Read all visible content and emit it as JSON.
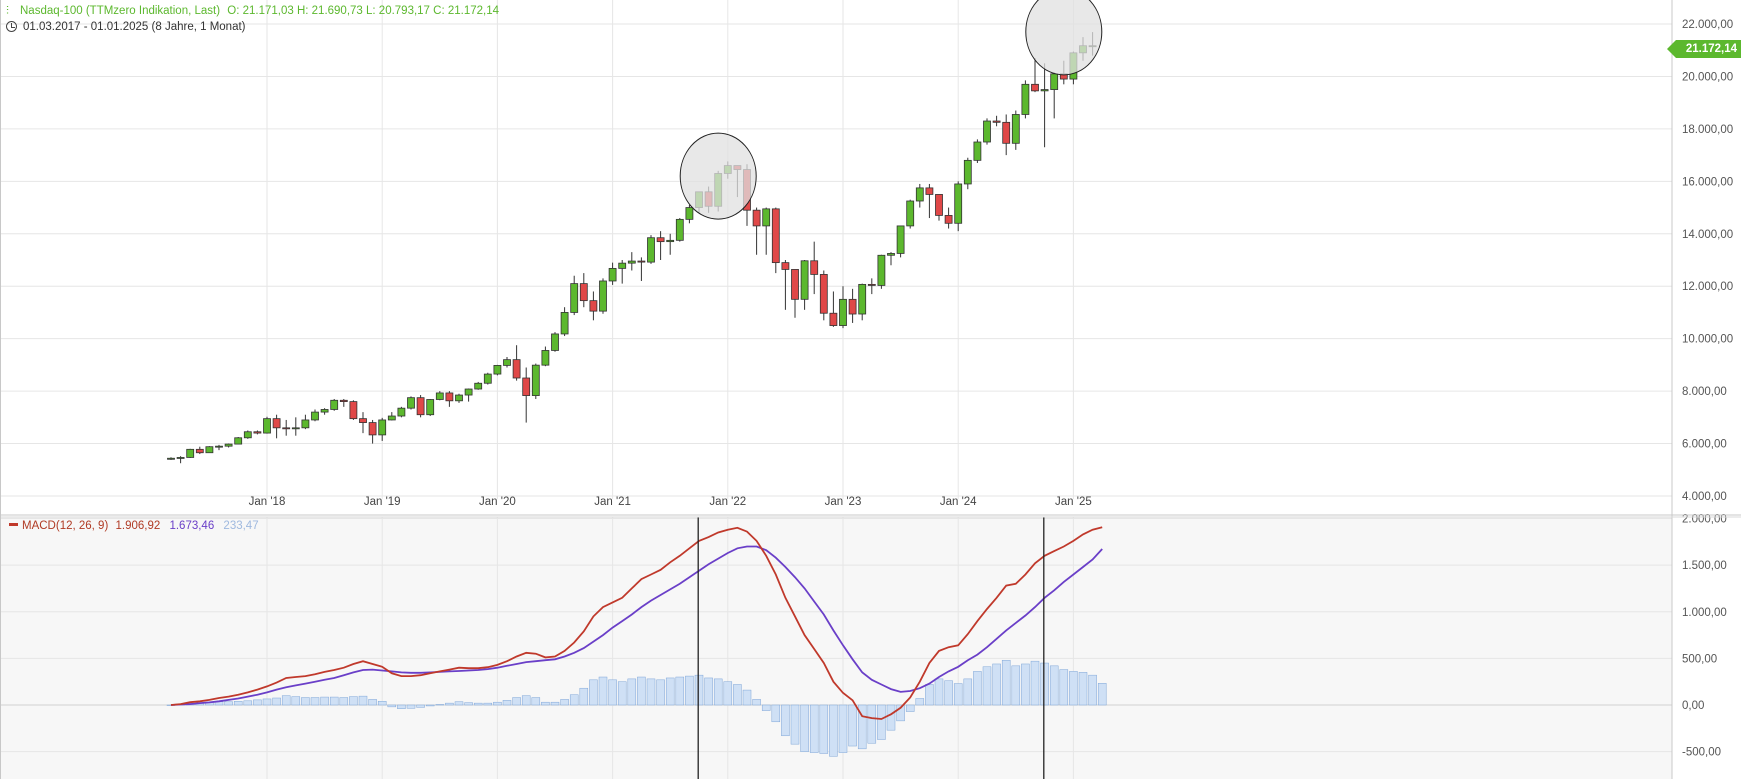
{
  "header": {
    "icon": "candlestick-icon",
    "instrument": "Nasdaq-100 (TTMzero Indikation, Last)",
    "ohlc": "O: 21.171,03   H: 21.690,73   L: 20.793,17   C: 21.172,14",
    "range_icon": "clock-icon",
    "range": "01.03.2017 - 01.01.2025   (8 Jahre, 1 Monat)"
  },
  "last_price_label": "21.172,14",
  "macd_legend": {
    "name": "MACD(12, 26, 9)",
    "macd_value": "1.906,92",
    "signal_value": "1.673,46",
    "hist_value": "233,47"
  },
  "colors": {
    "up": "#5cb82e",
    "down": "#e04848",
    "macd_line": "#c0392b",
    "signal_line": "#6a3fc8",
    "histogram": "#cfe0f5",
    "histogram_border": "#7fa6d8",
    "grid": "#e6e6e6",
    "highlight_circle": "#e0e0e0"
  },
  "chart_data": [
    {
      "type": "candlestick",
      "interval": "monthly",
      "start": "2017-03",
      "ylim": [
        4000,
        22000
      ],
      "y_ticks": [
        "4.000,00",
        "6.000,00",
        "8.000,00",
        "10.000,00",
        "12.000,00",
        "14.000,00",
        "16.000,00",
        "18.000,00",
        "20.000,00",
        "22.000,00"
      ],
      "x_ticks": [
        "Jan '18",
        "Jan '19",
        "Jan '20",
        "Jan '21",
        "Jan '22",
        "Jan '23",
        "Jan '24",
        "Jan '25"
      ],
      "ohlc": [
        [
          5400,
          5480,
          5380,
          5440
        ],
        [
          5440,
          5520,
          5250,
          5470
        ],
        [
          5470,
          5800,
          5450,
          5780
        ],
        [
          5780,
          5880,
          5600,
          5650
        ],
        [
          5650,
          5900,
          5640,
          5880
        ],
        [
          5880,
          5950,
          5750,
          5900
        ],
        [
          5900,
          6000,
          5850,
          5980
        ],
        [
          5980,
          6250,
          5970,
          6220
        ],
        [
          6220,
          6500,
          6180,
          6450
        ],
        [
          6450,
          6500,
          6350,
          6400
        ],
        [
          6400,
          7020,
          6380,
          6950
        ],
        [
          6950,
          7100,
          6200,
          6600
        ],
        [
          6600,
          6900,
          6300,
          6580
        ],
        [
          6580,
          7000,
          6300,
          6600
        ],
        [
          6600,
          7100,
          6550,
          6900
        ],
        [
          6900,
          7300,
          6850,
          7200
        ],
        [
          7200,
          7350,
          7100,
          7300
        ],
        [
          7300,
          7700,
          7250,
          7650
        ],
        [
          7650,
          7700,
          7400,
          7600
        ],
        [
          7600,
          7650,
          6900,
          6950
        ],
        [
          6950,
          7200,
          6400,
          6800
        ],
        [
          6800,
          6900,
          6000,
          6330
        ],
        [
          6330,
          6980,
          6100,
          6900
        ],
        [
          6900,
          7200,
          6880,
          7050
        ],
        [
          7050,
          7400,
          7000,
          7350
        ],
        [
          7350,
          7800,
          7300,
          7750
        ],
        [
          7750,
          7850,
          7000,
          7100
        ],
        [
          7100,
          7700,
          7050,
          7680
        ],
        [
          7680,
          8000,
          7650,
          7930
        ],
        [
          7930,
          8000,
          7400,
          7630
        ],
        [
          7630,
          7900,
          7550,
          7850
        ],
        [
          7850,
          8100,
          7600,
          8080
        ],
        [
          8080,
          8350,
          8050,
          8300
        ],
        [
          8300,
          8700,
          8250,
          8650
        ],
        [
          8650,
          9000,
          8600,
          8980
        ],
        [
          8980,
          9300,
          8900,
          9200
        ],
        [
          9200,
          9750,
          8400,
          8500
        ],
        [
          8500,
          8900,
          6800,
          7830
        ],
        [
          7830,
          9050,
          7700,
          8990
        ],
        [
          8990,
          9700,
          8950,
          9550
        ],
        [
          9550,
          10250,
          9500,
          10180
        ],
        [
          10180,
          11200,
          10100,
          11000
        ],
        [
          11000,
          12400,
          10900,
          12100
        ],
        [
          12100,
          12500,
          11200,
          11450
        ],
        [
          11450,
          11800,
          10700,
          11050
        ],
        [
          11050,
          12300,
          10950,
          12200
        ],
        [
          12200,
          12900,
          12050,
          12680
        ],
        [
          12680,
          13000,
          12100,
          12880
        ],
        [
          12880,
          13300,
          12600,
          12960
        ],
        [
          12960,
          13100,
          12200,
          12920
        ],
        [
          12920,
          13950,
          12850,
          13850
        ],
        [
          13850,
          14100,
          13000,
          13700
        ],
        [
          13700,
          14000,
          13200,
          13750
        ],
        [
          13750,
          14600,
          13700,
          14550
        ],
        [
          14550,
          15100,
          14400,
          15000
        ],
        [
          15000,
          15600,
          14800,
          15600
        ],
        [
          15600,
          15800,
          14800,
          15050
        ],
        [
          15050,
          16400,
          14850,
          16300
        ],
        [
          16300,
          16760,
          16100,
          16600
        ],
        [
          16600,
          16600,
          15400,
          16450
        ],
        [
          16450,
          16650,
          14300,
          14900
        ],
        [
          14900,
          15000,
          13200,
          14300
        ],
        [
          14300,
          15000,
          13200,
          14950
        ],
        [
          14950,
          15000,
          12500,
          12900
        ],
        [
          12900,
          13000,
          11100,
          12640
        ],
        [
          12640,
          12600,
          10800,
          11500
        ],
        [
          11500,
          13000,
          11100,
          12970
        ],
        [
          12970,
          13700,
          11700,
          12450
        ],
        [
          12450,
          12600,
          10700,
          10970
        ],
        [
          10970,
          11800,
          10450,
          10500
        ],
        [
          10500,
          12000,
          10400,
          11500
        ],
        [
          11500,
          11900,
          10600,
          10940
        ],
        [
          10940,
          12100,
          10700,
          12070
        ],
        [
          12070,
          12300,
          11700,
          12030
        ],
        [
          12030,
          13200,
          11900,
          13180
        ],
        [
          13180,
          13300,
          12800,
          13250
        ],
        [
          13250,
          14300,
          13100,
          14300
        ],
        [
          14300,
          15300,
          14200,
          15250
        ],
        [
          15250,
          15900,
          15000,
          15750
        ],
        [
          15750,
          15900,
          14600,
          15500
        ],
        [
          15500,
          15300,
          14500,
          14700
        ],
        [
          14700,
          15000,
          14200,
          14400
        ],
        [
          14400,
          16000,
          14100,
          15900
        ],
        [
          15900,
          16900,
          15700,
          16800
        ],
        [
          16800,
          17600,
          16700,
          17500
        ],
        [
          17500,
          18400,
          17400,
          18300
        ],
        [
          18300,
          18500,
          18100,
          18250
        ],
        [
          18250,
          18550,
          17000,
          17450
        ],
        [
          17450,
          18700,
          17200,
          18550
        ],
        [
          18550,
          19850,
          18400,
          19700
        ],
        [
          19700,
          20700,
          19400,
          19450
        ],
        [
          19450,
          20500,
          17300,
          19500
        ],
        [
          19500,
          20150,
          18400,
          20100
        ],
        [
          20100,
          20600,
          19700,
          19900
        ],
        [
          19900,
          20950,
          19700,
          20900
        ],
        [
          20900,
          21500,
          20600,
          21171
        ],
        [
          21171,
          21691,
          20793,
          21172
        ]
      ],
      "highlight_circles": [
        {
          "center_x": "2021-12",
          "center_y": 16200,
          "note": ""
        },
        {
          "center_x": "2024-12",
          "center_y": 21700,
          "note": ""
        }
      ]
    },
    {
      "type": "macd",
      "params": "12, 26, 9",
      "ylim": [
        -800,
        2000
      ],
      "y_ticks": [
        "-500,00",
        "0,00",
        "500,00",
        "1.000,00",
        "1.500,00",
        "2.000,00"
      ],
      "macd": [
        0,
        10,
        30,
        40,
        55,
        75,
        90,
        110,
        135,
        165,
        200,
        240,
        290,
        300,
        310,
        330,
        355,
        375,
        400,
        440,
        470,
        440,
        410,
        340,
        310,
        310,
        320,
        340,
        360,
        380,
        400,
        395,
        395,
        405,
        430,
        470,
        520,
        560,
        550,
        510,
        520,
        580,
        670,
        790,
        950,
        1050,
        1100,
        1150,
        1250,
        1350,
        1400,
        1450,
        1530,
        1600,
        1680,
        1760,
        1800,
        1850,
        1880,
        1900,
        1860,
        1760,
        1600,
        1400,
        1150,
        950,
        750,
        600,
        450,
        250,
        130,
        50,
        -120,
        -140,
        -150,
        -100,
        -30,
        80,
        250,
        450,
        580,
        620,
        640,
        760,
        900,
        1030,
        1150,
        1280,
        1300,
        1400,
        1520,
        1600,
        1650,
        1700,
        1760,
        1830,
        1880,
        1907
      ],
      "signal": [
        0,
        5,
        10,
        20,
        28,
        40,
        55,
        70,
        90,
        110,
        135,
        165,
        190,
        210,
        230,
        250,
        270,
        290,
        320,
        350,
        375,
        380,
        370,
        360,
        350,
        345,
        345,
        350,
        355,
        360,
        365,
        370,
        375,
        385,
        400,
        420,
        440,
        460,
        470,
        480,
        490,
        520,
        560,
        610,
        680,
        750,
        830,
        900,
        970,
        1050,
        1120,
        1180,
        1240,
        1300,
        1370,
        1440,
        1510,
        1570,
        1630,
        1680,
        1700,
        1700,
        1660,
        1580,
        1480,
        1370,
        1250,
        1110,
        970,
        800,
        640,
        490,
        350,
        270,
        220,
        170,
        140,
        150,
        180,
        230,
        300,
        360,
        410,
        480,
        540,
        620,
        710,
        800,
        880,
        960,
        1050,
        1150,
        1230,
        1320,
        1400,
        1480,
        1560,
        1673
      ],
      "histogram": [
        0,
        5,
        20,
        20,
        27,
        35,
        35,
        40,
        45,
        55,
        65,
        75,
        100,
        90,
        80,
        80,
        85,
        85,
        80,
        90,
        95,
        60,
        40,
        -20,
        -40,
        -35,
        -25,
        -10,
        5,
        20,
        35,
        25,
        20,
        20,
        30,
        50,
        80,
        100,
        80,
        30,
        30,
        60,
        110,
        180,
        270,
        300,
        270,
        250,
        280,
        300,
        280,
        270,
        290,
        300,
        310,
        320,
        290,
        280,
        250,
        220,
        160,
        60,
        -60,
        -180,
        -330,
        -420,
        -500,
        -510,
        -520,
        -550,
        -510,
        -440,
        -470,
        -410,
        -370,
        -270,
        -170,
        -70,
        70,
        220,
        280,
        260,
        230,
        280,
        360,
        410,
        440,
        480,
        420,
        440,
        470,
        450,
        420,
        380,
        360,
        350,
        320,
        233
      ]
    }
  ]
}
